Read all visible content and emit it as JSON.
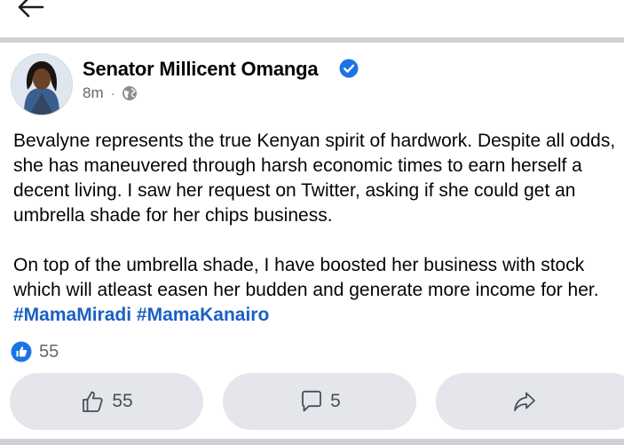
{
  "post": {
    "author": "Senator Millicent Omanga",
    "time": "8m",
    "privacy_icon": "globe-icon",
    "verified_icon": "verified-badge-icon",
    "paragraph1": "Bevalyne represents the true Kenyan spirit of hardwork. Despite all odds, she has maneuvered through harsh economic times to earn herself a decent living. I saw her request on Twitter, asking if she could get an umbrella shade for her chips business.",
    "paragraph2_text": "On top of the umbrella shade, I have boosted her business with stock which will atleast easen her budden and generate more income for her. ",
    "hashtags": [
      "#MamaMiradi",
      "#MamaKanairo"
    ]
  },
  "reactions": {
    "count": "55",
    "icon": "like-reaction-icon"
  },
  "actions": {
    "like_count": "55",
    "comment_count": "5",
    "share_icon": "share-icon"
  },
  "colors": {
    "accent": "#1b74e4",
    "hashtag": "#1b5fc5",
    "button_bg": "#e4e6eb",
    "divider": "#cfd2d6",
    "secondary_text": "#65676b"
  }
}
